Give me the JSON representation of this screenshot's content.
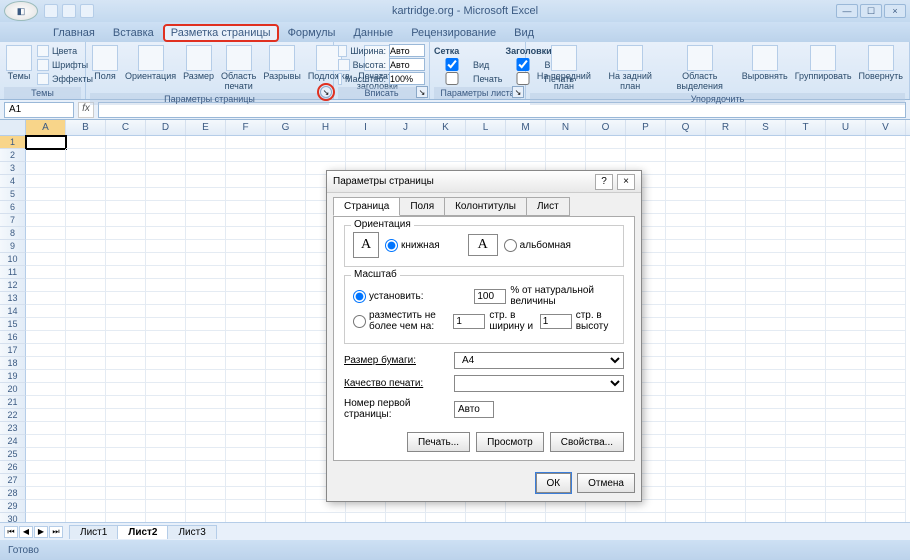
{
  "title": "kartridge.org - Microsoft Excel",
  "winbtns": {
    "min": "—",
    "max": "☐",
    "close": "×"
  },
  "tabs": [
    "Главная",
    "Вставка",
    "Разметка страницы",
    "Формулы",
    "Данные",
    "Рецензирование",
    "Вид"
  ],
  "activeTab": 2,
  "ribbon": {
    "themes": {
      "title": "Темы",
      "main": "Темы",
      "colors": "Цвета",
      "fonts": "Шрифты",
      "effects": "Эффекты"
    },
    "pageSetup": {
      "title": "Параметры страницы",
      "margins": "Поля",
      "orientation": "Ориентация",
      "size": "Размер",
      "printArea": "Область печати",
      "breaks": "Разрывы",
      "background": "Подложка",
      "printTitles": "Печатать заголовки"
    },
    "scaleToFit": {
      "title": "Вписать",
      "width": "Ширина:",
      "height": "Высота:",
      "scale": "Масштаб:",
      "auto": "Авто",
      "scaleVal": "100%"
    },
    "sheetOptions": {
      "title": "Параметры листа",
      "gridlines": "Сетка",
      "headings": "Заголовки",
      "view": "Вид",
      "print": "Печать"
    },
    "arrange": {
      "title": "Упорядочить",
      "front": "На передний план",
      "back": "На задний план",
      "selection": "Область выделения",
      "align": "Выровнять",
      "group": "Группировать",
      "rotate": "Повернуть"
    }
  },
  "nameBox": "A1",
  "columns": [
    "A",
    "B",
    "C",
    "D",
    "E",
    "F",
    "G",
    "H",
    "I",
    "J",
    "K",
    "L",
    "M",
    "N",
    "O",
    "P",
    "Q",
    "R",
    "S",
    "T",
    "U",
    "V"
  ],
  "rowCount": 32,
  "sheets": [
    "Лист1",
    "Лист2",
    "Лист3"
  ],
  "activeSheet": 1,
  "status": "Готово",
  "dialog": {
    "title": "Параметры страницы",
    "help": "?",
    "close": "×",
    "tabs": [
      "Страница",
      "Поля",
      "Колонтитулы",
      "Лист"
    ],
    "activeTab": 0,
    "orientation": {
      "legend": "Ориентация",
      "portrait": "книжная",
      "landscape": "альбомная"
    },
    "scale": {
      "legend": "Масштаб",
      "adjust": "установить:",
      "adjustVal": "100",
      "adjustSuffix": "% от натуральной величины",
      "fit": "разместить не более чем на:",
      "fitW": "1",
      "fitWLabel": "стр. в ширину и",
      "fitH": "1",
      "fitHLabel": "стр. в высоту"
    },
    "paperSize": {
      "label": "Размер бумаги:",
      "value": "A4"
    },
    "printQuality": {
      "label": "Качество печати:",
      "value": ""
    },
    "firstPage": {
      "label": "Номер первой страницы:",
      "value": "Авто"
    },
    "buttons": {
      "print": "Печать...",
      "preview": "Просмотр",
      "props": "Свойства...",
      "ok": "ОК",
      "cancel": "Отмена"
    }
  }
}
